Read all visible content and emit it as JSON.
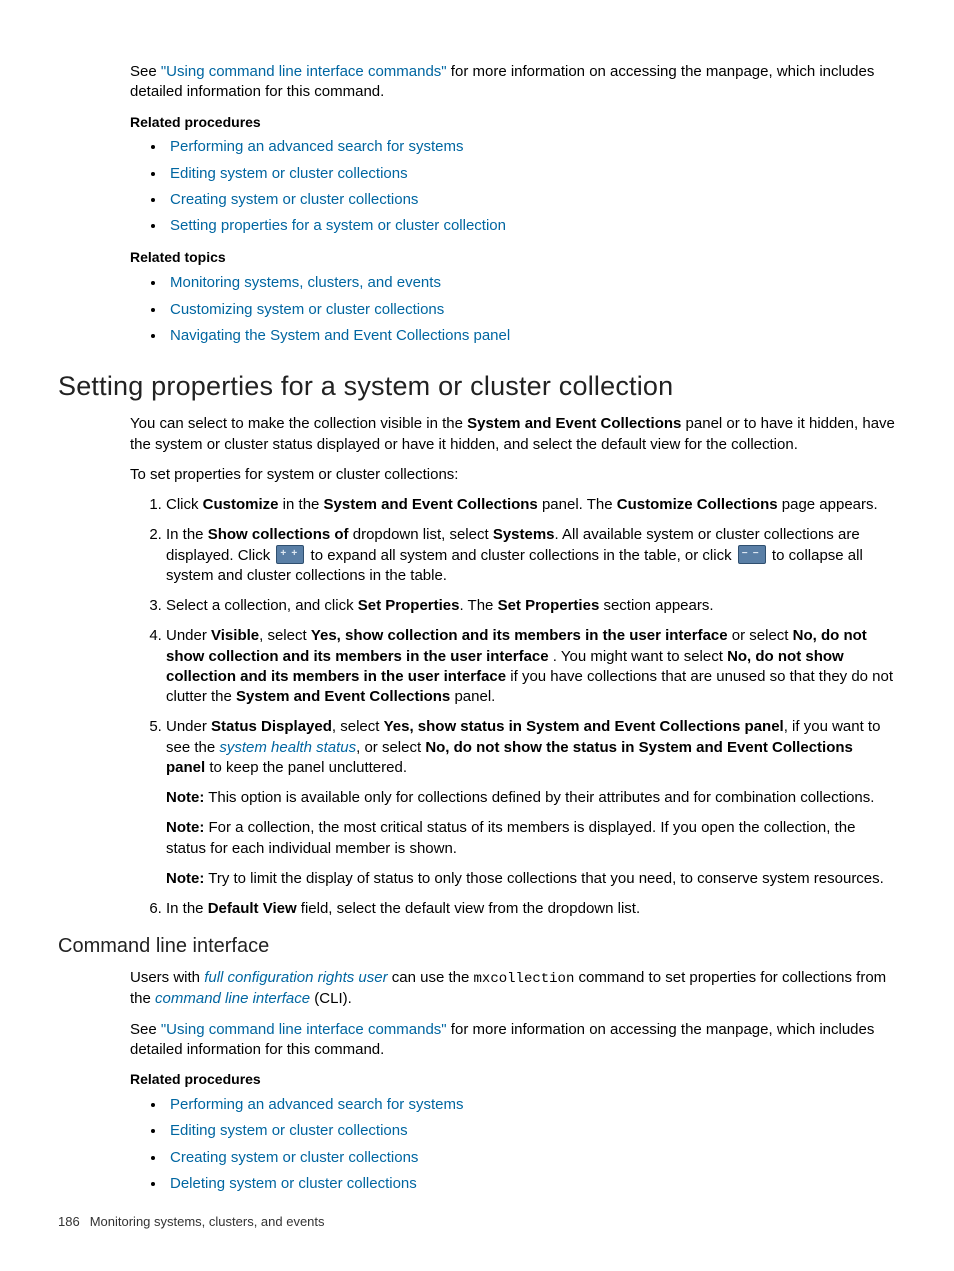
{
  "intro": {
    "see_prefix": "See ",
    "see_link": "\"Using command line interface commands\"",
    "see_suffix": " for more information on accessing the manpage, which includes detailed information for this command."
  },
  "related_procedures_label": "Related procedures",
  "related_topics_label": "Related topics",
  "rp1": [
    "Performing an advanced search for systems",
    "Editing system or cluster collections",
    "Creating system or cluster collections",
    "Setting properties for a system or cluster collection"
  ],
  "rt1": [
    "Monitoring systems, clusters, and events",
    "Customizing system or cluster collections",
    "Navigating the System and Event Collections panel"
  ],
  "h1": "Setting properties for a system or cluster collection",
  "para1_a": "You can select to make the collection visible in the ",
  "para1_b": "System and Event Collections",
  "para1_c": " panel or to have it hidden, have the system or cluster status displayed or have it hidden, and select the default view for the collection.",
  "para2": "To set properties for system or cluster collections:",
  "step1": {
    "a": "Click ",
    "b": "Customize",
    "c": " in the ",
    "d": "System and Event Collections",
    "e": " panel. The ",
    "f": "Customize Collections",
    "g": " page appears."
  },
  "step2": {
    "a": "In the ",
    "b": "Show collections of",
    "c": " dropdown list, select ",
    "d": "Systems",
    "e": ". All available system or cluster collections are displayed. Click ",
    "f": " to expand all system and cluster collections in the table, or click ",
    "g": " to collapse all system and cluster collections in the table."
  },
  "step3": {
    "a": "Select a collection, and click ",
    "b": "Set Properties",
    "c": ". The ",
    "d": "Set Properties",
    "e": " section appears."
  },
  "step4": {
    "a": "Under ",
    "b": "Visible",
    "c": ", select ",
    "d": "Yes, show collection and its members in the user interface ",
    "e": " or select ",
    "f": "No, do not show collection and its members in the user interface ",
    "g": ". You might want to select ",
    "h": "No, do not show collection and its members in the user interface ",
    "i": " if you have collections that are unused so that they do not clutter the ",
    "j": "System and Event Collections",
    "k": " panel."
  },
  "step5": {
    "a": "Under ",
    "b": "Status Displayed",
    "c": ", select ",
    "d": "Yes, show status in System and Event Collections panel",
    "e": ", if you want to see the ",
    "f": "system health status",
    "g": ", or select ",
    "h": "No, do not show the status in System and Event Collections panel",
    "i": " to keep the panel uncluttered.",
    "note_label": "Note:",
    "note1": " This option is available only for collections defined by their attributes and for combination collections.",
    "note2": " For a collection, the most critical status of its members is displayed. If you open the collection, the status for each individual member is shown.",
    "note3": " Try to limit the display of status to only those collections that you need, to conserve system resources."
  },
  "step6": {
    "a": "In the ",
    "b": "Default View",
    "c": " field, select the default view from the dropdown list."
  },
  "h2": "Command line interface",
  "cli": {
    "a": "Users with ",
    "b": "full configuration rights user",
    "c": " can use the ",
    "d": "mxcollection",
    "e": " command to set properties for collections from the ",
    "f": "command line interface",
    "g": " (CLI)."
  },
  "cli_see": {
    "a": "See ",
    "b": "\"Using command line interface commands\"",
    "c": " for more information on accessing the manpage, which includes detailed information for this command."
  },
  "rp2": [
    "Performing an advanced search for systems",
    "Editing system or cluster collections",
    "Creating system or cluster collections",
    "Deleting system or cluster collections"
  ],
  "footer": {
    "page": "186",
    "title": "Monitoring systems, clusters, and events"
  }
}
